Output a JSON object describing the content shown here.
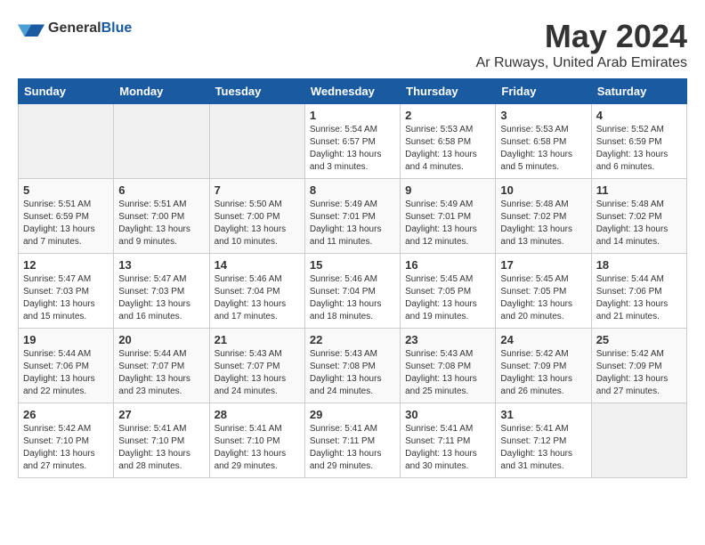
{
  "logo": {
    "general": "General",
    "blue": "Blue"
  },
  "title": {
    "month": "May 2024",
    "location": "Ar Ruways, United Arab Emirates"
  },
  "headers": [
    "Sunday",
    "Monday",
    "Tuesday",
    "Wednesday",
    "Thursday",
    "Friday",
    "Saturday"
  ],
  "weeks": [
    [
      {
        "day": "",
        "sunrise": "",
        "sunset": "",
        "daylight": ""
      },
      {
        "day": "",
        "sunrise": "",
        "sunset": "",
        "daylight": ""
      },
      {
        "day": "",
        "sunrise": "",
        "sunset": "",
        "daylight": ""
      },
      {
        "day": "1",
        "sunrise": "Sunrise: 5:54 AM",
        "sunset": "Sunset: 6:57 PM",
        "daylight": "Daylight: 13 hours and 3 minutes."
      },
      {
        "day": "2",
        "sunrise": "Sunrise: 5:53 AM",
        "sunset": "Sunset: 6:58 PM",
        "daylight": "Daylight: 13 hours and 4 minutes."
      },
      {
        "day": "3",
        "sunrise": "Sunrise: 5:53 AM",
        "sunset": "Sunset: 6:58 PM",
        "daylight": "Daylight: 13 hours and 5 minutes."
      },
      {
        "day": "4",
        "sunrise": "Sunrise: 5:52 AM",
        "sunset": "Sunset: 6:59 PM",
        "daylight": "Daylight: 13 hours and 6 minutes."
      }
    ],
    [
      {
        "day": "5",
        "sunrise": "Sunrise: 5:51 AM",
        "sunset": "Sunset: 6:59 PM",
        "daylight": "Daylight: 13 hours and 7 minutes."
      },
      {
        "day": "6",
        "sunrise": "Sunrise: 5:51 AM",
        "sunset": "Sunset: 7:00 PM",
        "daylight": "Daylight: 13 hours and 9 minutes."
      },
      {
        "day": "7",
        "sunrise": "Sunrise: 5:50 AM",
        "sunset": "Sunset: 7:00 PM",
        "daylight": "Daylight: 13 hours and 10 minutes."
      },
      {
        "day": "8",
        "sunrise": "Sunrise: 5:49 AM",
        "sunset": "Sunset: 7:01 PM",
        "daylight": "Daylight: 13 hours and 11 minutes."
      },
      {
        "day": "9",
        "sunrise": "Sunrise: 5:49 AM",
        "sunset": "Sunset: 7:01 PM",
        "daylight": "Daylight: 13 hours and 12 minutes."
      },
      {
        "day": "10",
        "sunrise": "Sunrise: 5:48 AM",
        "sunset": "Sunset: 7:02 PM",
        "daylight": "Daylight: 13 hours and 13 minutes."
      },
      {
        "day": "11",
        "sunrise": "Sunrise: 5:48 AM",
        "sunset": "Sunset: 7:02 PM",
        "daylight": "Daylight: 13 hours and 14 minutes."
      }
    ],
    [
      {
        "day": "12",
        "sunrise": "Sunrise: 5:47 AM",
        "sunset": "Sunset: 7:03 PM",
        "daylight": "Daylight: 13 hours and 15 minutes."
      },
      {
        "day": "13",
        "sunrise": "Sunrise: 5:47 AM",
        "sunset": "Sunset: 7:03 PM",
        "daylight": "Daylight: 13 hours and 16 minutes."
      },
      {
        "day": "14",
        "sunrise": "Sunrise: 5:46 AM",
        "sunset": "Sunset: 7:04 PM",
        "daylight": "Daylight: 13 hours and 17 minutes."
      },
      {
        "day": "15",
        "sunrise": "Sunrise: 5:46 AM",
        "sunset": "Sunset: 7:04 PM",
        "daylight": "Daylight: 13 hours and 18 minutes."
      },
      {
        "day": "16",
        "sunrise": "Sunrise: 5:45 AM",
        "sunset": "Sunset: 7:05 PM",
        "daylight": "Daylight: 13 hours and 19 minutes."
      },
      {
        "day": "17",
        "sunrise": "Sunrise: 5:45 AM",
        "sunset": "Sunset: 7:05 PM",
        "daylight": "Daylight: 13 hours and 20 minutes."
      },
      {
        "day": "18",
        "sunrise": "Sunrise: 5:44 AM",
        "sunset": "Sunset: 7:06 PM",
        "daylight": "Daylight: 13 hours and 21 minutes."
      }
    ],
    [
      {
        "day": "19",
        "sunrise": "Sunrise: 5:44 AM",
        "sunset": "Sunset: 7:06 PM",
        "daylight": "Daylight: 13 hours and 22 minutes."
      },
      {
        "day": "20",
        "sunrise": "Sunrise: 5:44 AM",
        "sunset": "Sunset: 7:07 PM",
        "daylight": "Daylight: 13 hours and 23 minutes."
      },
      {
        "day": "21",
        "sunrise": "Sunrise: 5:43 AM",
        "sunset": "Sunset: 7:07 PM",
        "daylight": "Daylight: 13 hours and 24 minutes."
      },
      {
        "day": "22",
        "sunrise": "Sunrise: 5:43 AM",
        "sunset": "Sunset: 7:08 PM",
        "daylight": "Daylight: 13 hours and 24 minutes."
      },
      {
        "day": "23",
        "sunrise": "Sunrise: 5:43 AM",
        "sunset": "Sunset: 7:08 PM",
        "daylight": "Daylight: 13 hours and 25 minutes."
      },
      {
        "day": "24",
        "sunrise": "Sunrise: 5:42 AM",
        "sunset": "Sunset: 7:09 PM",
        "daylight": "Daylight: 13 hours and 26 minutes."
      },
      {
        "day": "25",
        "sunrise": "Sunrise: 5:42 AM",
        "sunset": "Sunset: 7:09 PM",
        "daylight": "Daylight: 13 hours and 27 minutes."
      }
    ],
    [
      {
        "day": "26",
        "sunrise": "Sunrise: 5:42 AM",
        "sunset": "Sunset: 7:10 PM",
        "daylight": "Daylight: 13 hours and 27 minutes."
      },
      {
        "day": "27",
        "sunrise": "Sunrise: 5:41 AM",
        "sunset": "Sunset: 7:10 PM",
        "daylight": "Daylight: 13 hours and 28 minutes."
      },
      {
        "day": "28",
        "sunrise": "Sunrise: 5:41 AM",
        "sunset": "Sunset: 7:10 PM",
        "daylight": "Daylight: 13 hours and 29 minutes."
      },
      {
        "day": "29",
        "sunrise": "Sunrise: 5:41 AM",
        "sunset": "Sunset: 7:11 PM",
        "daylight": "Daylight: 13 hours and 29 minutes."
      },
      {
        "day": "30",
        "sunrise": "Sunrise: 5:41 AM",
        "sunset": "Sunset: 7:11 PM",
        "daylight": "Daylight: 13 hours and 30 minutes."
      },
      {
        "day": "31",
        "sunrise": "Sunrise: 5:41 AM",
        "sunset": "Sunset: 7:12 PM",
        "daylight": "Daylight: 13 hours and 31 minutes."
      },
      {
        "day": "",
        "sunrise": "",
        "sunset": "",
        "daylight": ""
      }
    ]
  ]
}
